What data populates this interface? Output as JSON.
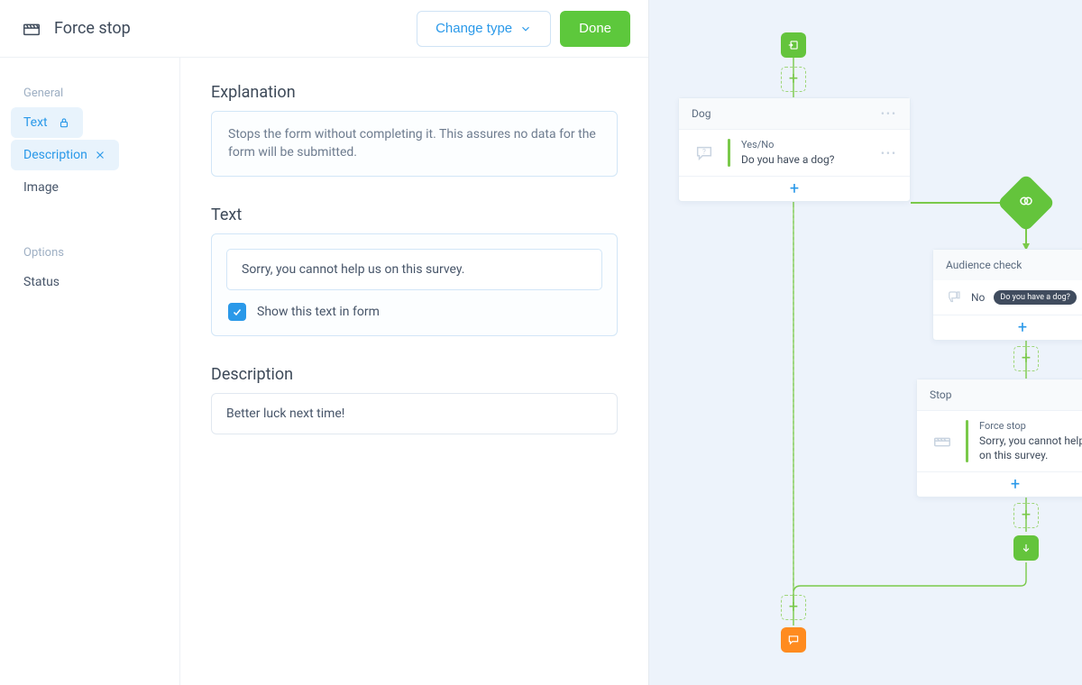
{
  "header": {
    "title": "Force stop",
    "change_type": "Change type",
    "done": "Done"
  },
  "sidebar": {
    "group_general": "General",
    "group_options": "Options",
    "items": {
      "text": "Text",
      "description": "Description",
      "image": "Image",
      "status": "Status"
    }
  },
  "content": {
    "explanation": {
      "label": "Explanation",
      "text": "Stops the form without completing it. This assures no data for the form will be submitted."
    },
    "text": {
      "label": "Text",
      "value": "Sorry, you cannot help us on this survey.",
      "show_in_form": "Show this text in form"
    },
    "description": {
      "label": "Description",
      "value": "Better luck next time!"
    }
  },
  "flow": {
    "dog": {
      "title": "Dog",
      "qtype": "Yes/No",
      "qtext": "Do you have a dog?"
    },
    "audience": {
      "title": "Audience check",
      "no": "No",
      "cond": "Do you have a dog?"
    },
    "stop": {
      "title": "Stop",
      "qtype": "Force stop",
      "qtext": "Sorry, you cannot help us on this survey."
    }
  },
  "colors": {
    "accent_blue": "#2a99e9",
    "accent_green": "#5dc83c",
    "accent_orange": "#ff8b1f",
    "canvas_bg": "#edf3fb"
  }
}
